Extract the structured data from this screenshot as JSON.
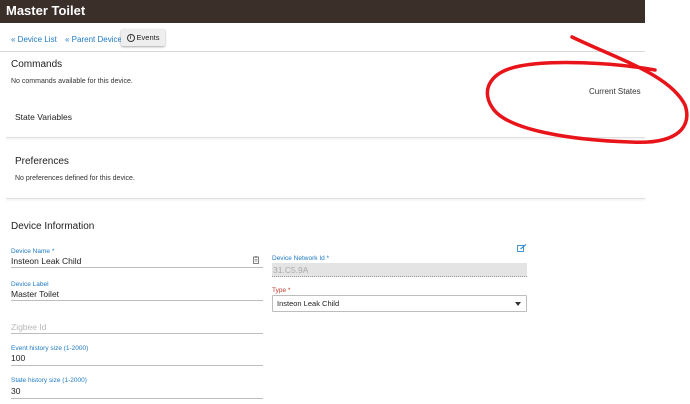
{
  "header": {
    "title": "Master Toilet"
  },
  "nav": {
    "device_list": "« Device List",
    "parent_device": "« Parent Device",
    "events": "Events"
  },
  "commands": {
    "title": "Commands",
    "empty": "No commands available for this device."
  },
  "current_states": {
    "title": "Current States"
  },
  "state_variables": {
    "title": "State Variables"
  },
  "preferences": {
    "title": "Preferences",
    "empty": "No preferences defined for this device."
  },
  "device_info": {
    "title": "Device Information",
    "device_name": {
      "label": "Device Name *",
      "value": "Insteon Leak Child"
    },
    "device_label": {
      "label": "Device Label",
      "value": "Master Toilet"
    },
    "zigbee_id": {
      "placeholder": "Zigbee Id"
    },
    "event_history": {
      "label": "Event history size (1-2000)",
      "value": "100"
    },
    "state_history": {
      "label": "State history size (1-2000)",
      "value": "30"
    },
    "network_id": {
      "label": "Device Network Id *",
      "value": "31.C5.9A"
    },
    "type": {
      "label": "Type *",
      "value": "Insteon Leak Child"
    }
  },
  "colors": {
    "topbar": "#3b2f2a",
    "link": "#1f7ac4",
    "required_label": "#c0392b",
    "annotation": "#e8141a"
  },
  "icons": [
    "info-icon",
    "edit-icon",
    "clipboard-icon",
    "chevron-down-icon"
  ]
}
